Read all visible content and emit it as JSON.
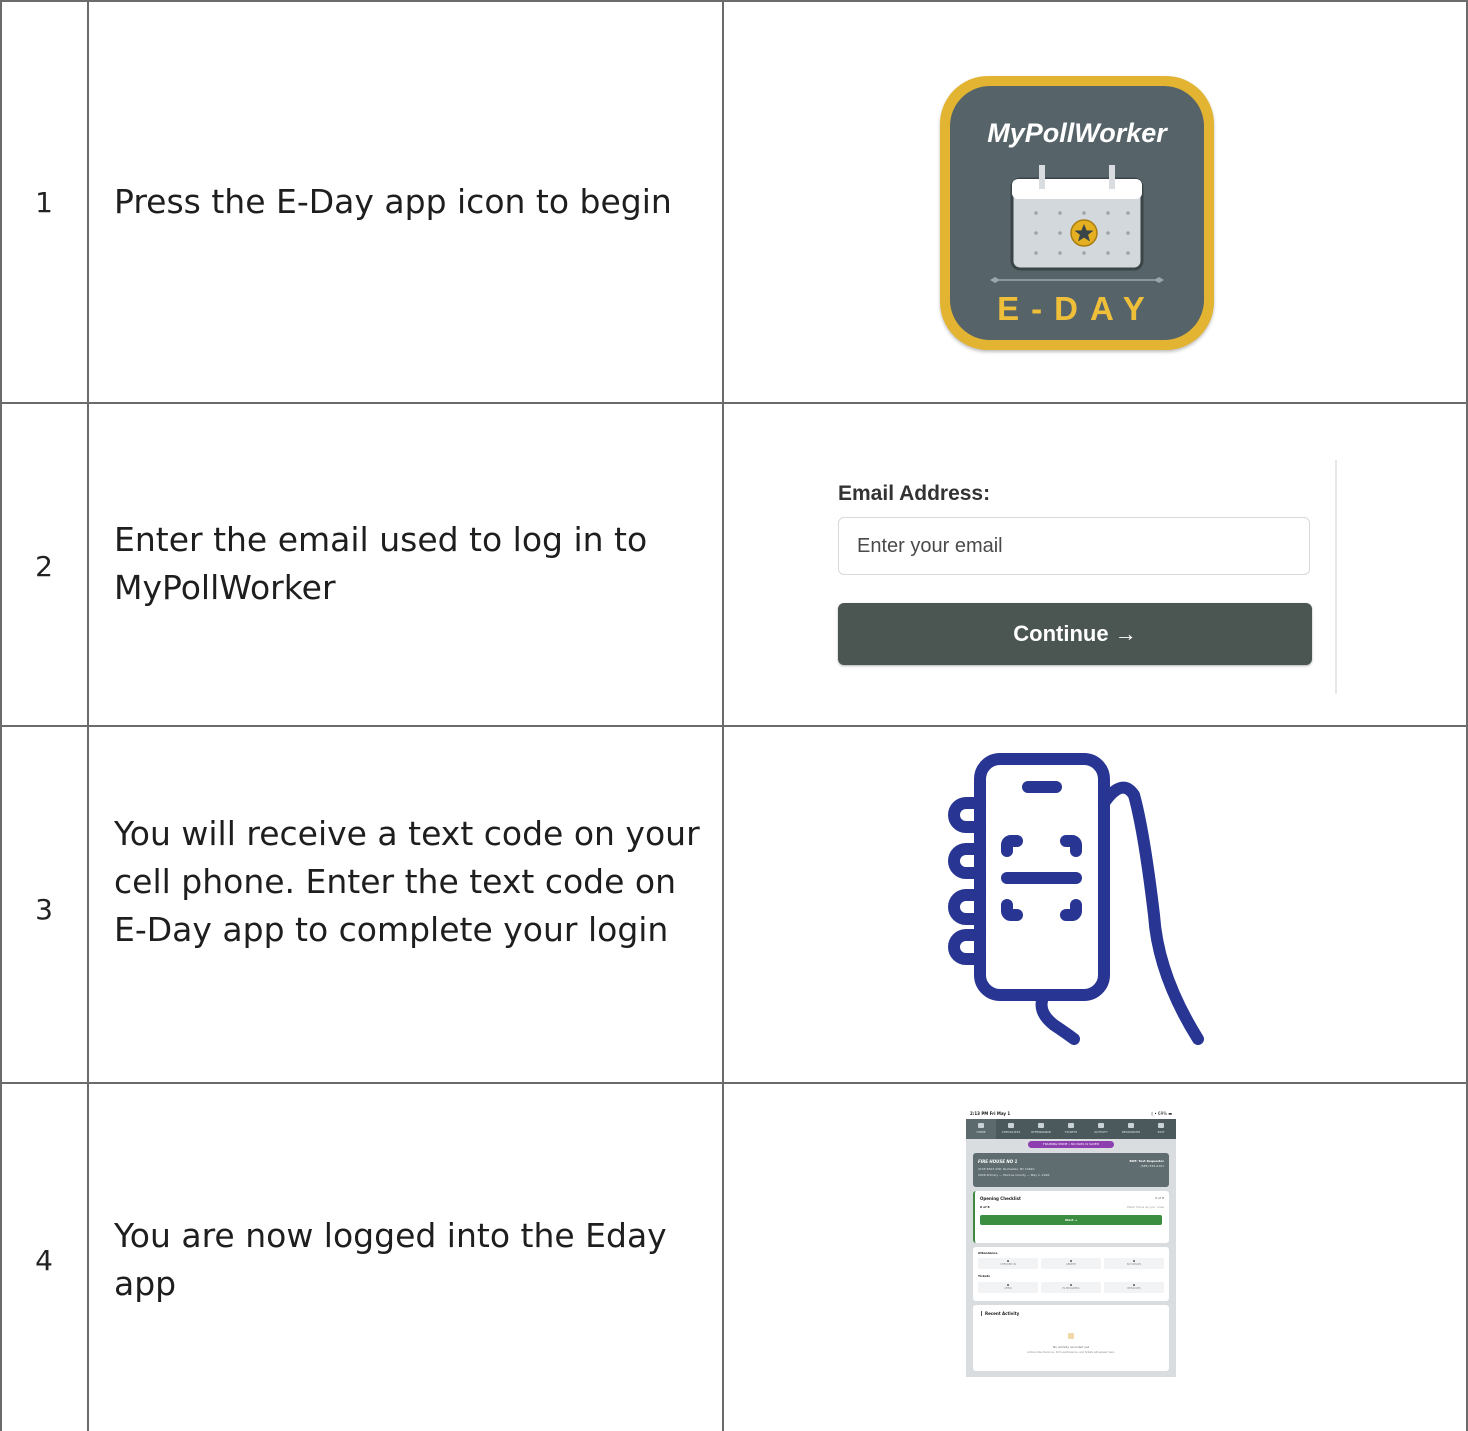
{
  "rows": [
    {
      "number": "1",
      "text": "Press the E-Day app icon to begin"
    },
    {
      "number": "2",
      "text": "Enter  the email used to log in to MyPollWorker"
    },
    {
      "number": "3",
      "text": "You will receive a text code on your cell phone. Enter the text code on E-Day app to complete your login"
    },
    {
      "number": "4",
      "text": "You are now logged into the Eday app"
    }
  ],
  "app_icon": {
    "title": "MyPollWorker",
    "label": "E-DAY",
    "colors": {
      "frame": "#e2b431",
      "body": "#566469",
      "label": "#efbf3a"
    }
  },
  "login": {
    "email_label": "Email Address:",
    "email_placeholder": "Enter your email",
    "continue_label": "Continue →",
    "button_color": "#4b5652"
  },
  "phone_illustration": {
    "icon": "hand-holding-phone-icon",
    "color": "#283593"
  },
  "app_screenshot": {
    "status_left": "2:13 PM  Fri May 1",
    "status_right": "◊ • 69% ▬",
    "nav": [
      "HOME",
      "CHECKLISTS",
      "ATTENDANCE",
      "TICKETS",
      "ACTIVITY",
      "RESOURCES",
      "EXIT"
    ],
    "mode_pill": "TRAINING MODE • NO DATA IS SAVED",
    "location_name": "FIRE HOUSE NO 1",
    "location_address": "2155 EAST AVE, Rochester, NY 14610",
    "election": "2026 Primary — Monroe County — May 1, 2026",
    "contact_name": "BOE: Test Requester",
    "contact_phone": "(585) 555-0101",
    "checklist_title": "Opening Checklist",
    "checklist_count": "0 of 8",
    "checklist_progress": "0 of 8",
    "checklist_message": "Mark 'Done as you' ones",
    "start_label": "Start →",
    "attendance_title": "Attendance",
    "attendance": [
      {
        "value": "0",
        "label": "CHECKED IN"
      },
      {
        "value": "0",
        "label": "ABSENT"
      },
      {
        "value": "0",
        "label": "NO SHOWS"
      }
    ],
    "tickets_title": "Tickets",
    "tickets": [
      {
        "value": "0",
        "label": "OPEN"
      },
      {
        "value": "0",
        "label": "IN PROGRESS"
      },
      {
        "value": "0",
        "label": "RESOLVED"
      }
    ],
    "recent_title": "Recent Activity",
    "recent_empty": "No activity recorded yet",
    "recent_hint": "Actions like check-ins, form submissions, and tickets will appear here."
  }
}
